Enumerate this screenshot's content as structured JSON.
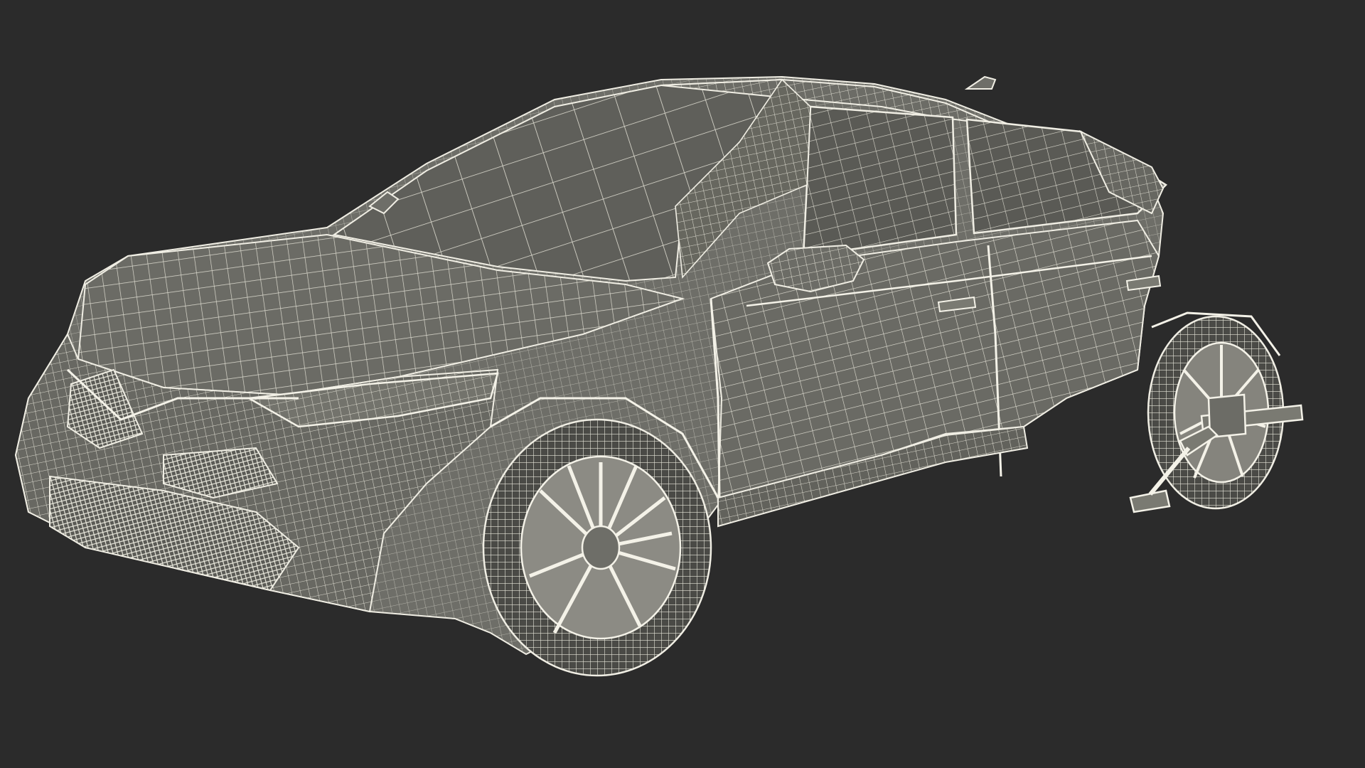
{
  "scene": {
    "subject": "sedan-wireframe-render",
    "colors": {
      "background": "#2b2b2b",
      "body_fill": "#6e6e68",
      "body_fill_dark": "#5c5c56",
      "glass_fill": "#5a5a55",
      "wire": "#e8e6da",
      "wire_dense": "#f2f0e6",
      "tire_fill": "#4a4a46",
      "rim_fill": "#8c8b84"
    }
  }
}
